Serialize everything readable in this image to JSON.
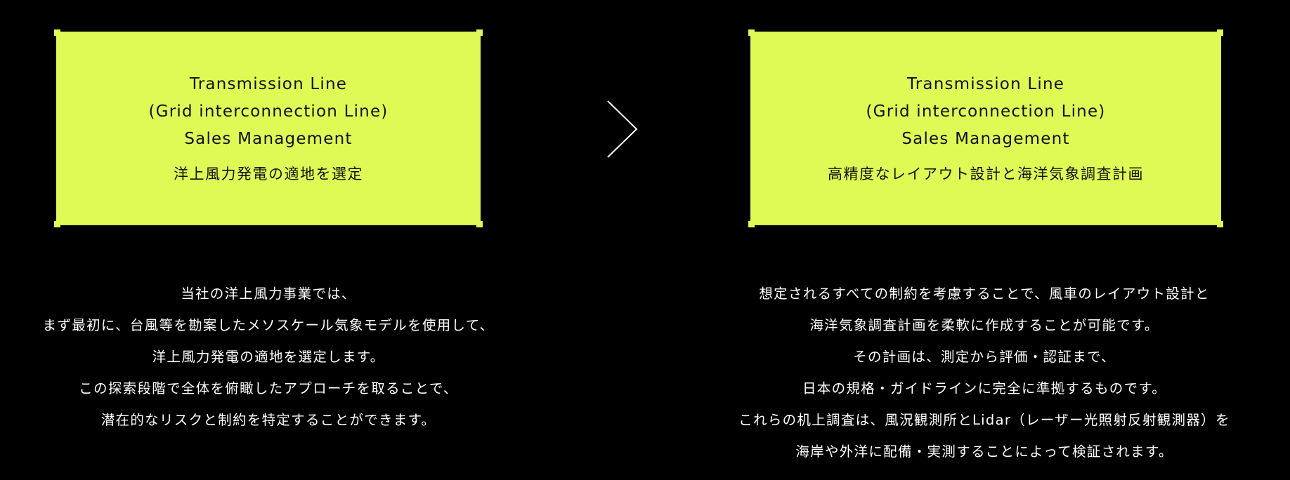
{
  "colors": {
    "background": "#000000",
    "card": "#e0fa55",
    "card_text": "#111111",
    "body_text": "#ffffff"
  },
  "left_card": {
    "title_lines": "Transmission Line\n(Grid interconnection Line)\nSales Management",
    "subtitle": "洋上風力発電の適地を選定"
  },
  "right_card": {
    "title_lines": "Transmission Line\n(Grid interconnection Line)\nSales Management",
    "subtitle": "高精度なレイアウト設計と海洋気象調査計画"
  },
  "arrow_icon": "chevron-right-icon",
  "left_description": [
    "当社の洋上風力事業では、",
    "まず最初に、台風等を勘案したメソスケール気象モデルを使用して、",
    "洋上風力発電の適地を選定します。",
    "この探索段階で全体を俯瞰したアプローチを取ることで、",
    "潜在的なリスクと制約を特定することができます。"
  ],
  "right_description": [
    "想定されるすべての制約を考慮することで、風車のレイアウト設計と",
    "海洋気象調査計画を柔軟に作成することが可能です。",
    "その計画は、測定から評価・認証まで、",
    "日本の規格・ガイドラインに完全に準拠するものです。",
    "これらの机上調査は、風況観測所とLidar（レーザー光照射反射観測器）を",
    "海岸や外洋に配備・実測することによって検証されます。"
  ]
}
